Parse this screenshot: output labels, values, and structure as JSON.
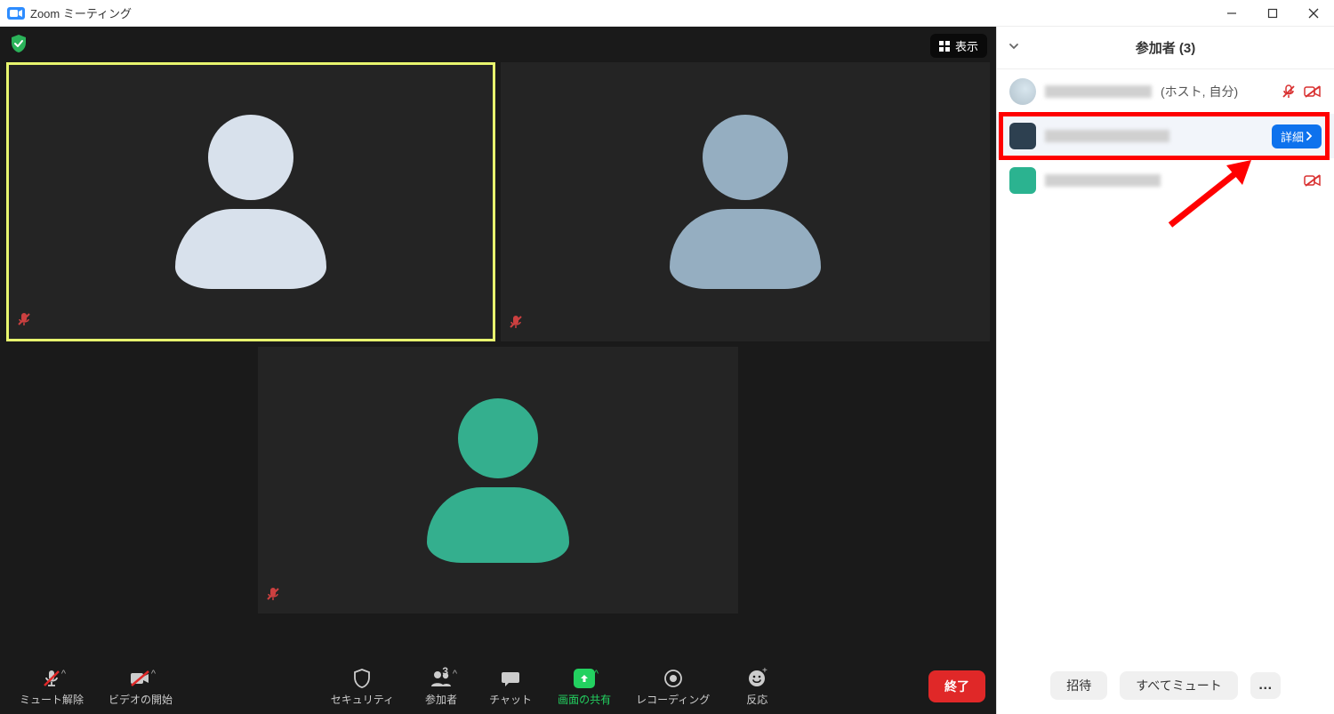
{
  "titlebar": {
    "title": "Zoom ミーティング"
  },
  "meeting": {
    "view_button": "表示",
    "tiles": [
      {
        "color": "#d8e1ec",
        "active": true,
        "muted": true
      },
      {
        "color": "#95aec1",
        "active": false,
        "muted": true
      },
      {
        "color": "#34af8e",
        "active": false,
        "muted": true
      }
    ]
  },
  "toolbar": {
    "mute": "ミュート解除",
    "video": "ビデオの開始",
    "security": "セキュリティ",
    "participants": "参加者",
    "participants_count": "3",
    "chat": "チャット",
    "share": "画面の共有",
    "record": "レコーディング",
    "reactions": "反応",
    "end": "終了"
  },
  "panel": {
    "title": "参加者 (3)",
    "participants": [
      {
        "meta": "(ホスト, 自分)",
        "avatar_color": "round",
        "mic_muted": true,
        "cam_off": true,
        "detail": false
      },
      {
        "meta": "",
        "avatar_color": "#2d4050",
        "mic_muted": false,
        "cam_off": false,
        "detail": true
      },
      {
        "meta": "",
        "avatar_color": "#2bb390",
        "mic_muted": false,
        "cam_off": true,
        "detail": false
      }
    ],
    "detail_label": "詳細",
    "footer": {
      "invite": "招待",
      "mute_all": "すべてミュート"
    }
  },
  "colors": {
    "accent_blue": "#0e72ed",
    "green": "#23d160",
    "red": "#e02828"
  }
}
